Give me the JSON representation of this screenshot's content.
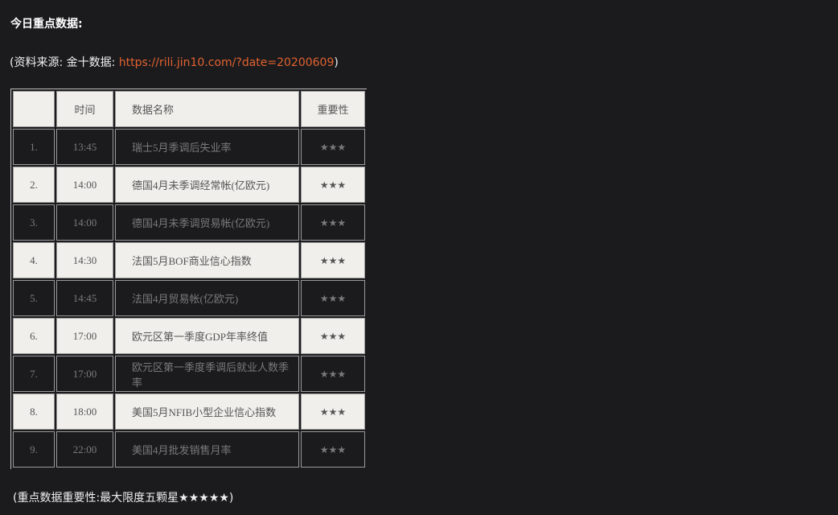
{
  "heading": "今日重点数据:",
  "source": {
    "prefix": "(资料来源: 金十数据: ",
    "link_text": "https://rili.jin10.com/?date=20200609",
    "suffix": ")"
  },
  "table": {
    "headers": [
      "",
      "时间",
      "数据名称",
      "重要性"
    ],
    "rows": [
      {
        "index": "1.",
        "time": "13:45",
        "name": "瑞士5月季调后失业率",
        "importance": "★★★"
      },
      {
        "index": "2.",
        "time": "14:00",
        "name": "德国4月未季调经常帐(亿欧元)",
        "importance": "★★★"
      },
      {
        "index": "3.",
        "time": "14:00",
        "name": "德国4月未季调贸易帐(亿欧元)",
        "importance": "★★★"
      },
      {
        "index": "4.",
        "time": "14:30",
        "name": "法国5月BOF商业信心指数",
        "importance": "★★★"
      },
      {
        "index": "5.",
        "time": "14:45",
        "name": "法国4月贸易帐(亿欧元)",
        "importance": "★★★"
      },
      {
        "index": "6.",
        "time": "17:00",
        "name": "欧元区第一季度GDP年率终值",
        "importance": "★★★"
      },
      {
        "index": "7.",
        "time": "17:00",
        "name": "欧元区第一季度季调后就业人数季率",
        "importance": "★★★"
      },
      {
        "index": "8.",
        "time": "18:00",
        "name": "美国5月NFIB小型企业信心指数",
        "importance": "★★★"
      },
      {
        "index": "9.",
        "time": "22:00",
        "name": "美国4月批发销售月率",
        "importance": "★★★"
      }
    ]
  },
  "footnote": "(重点数据重要性:最大限度五颗星★★★★★)"
}
